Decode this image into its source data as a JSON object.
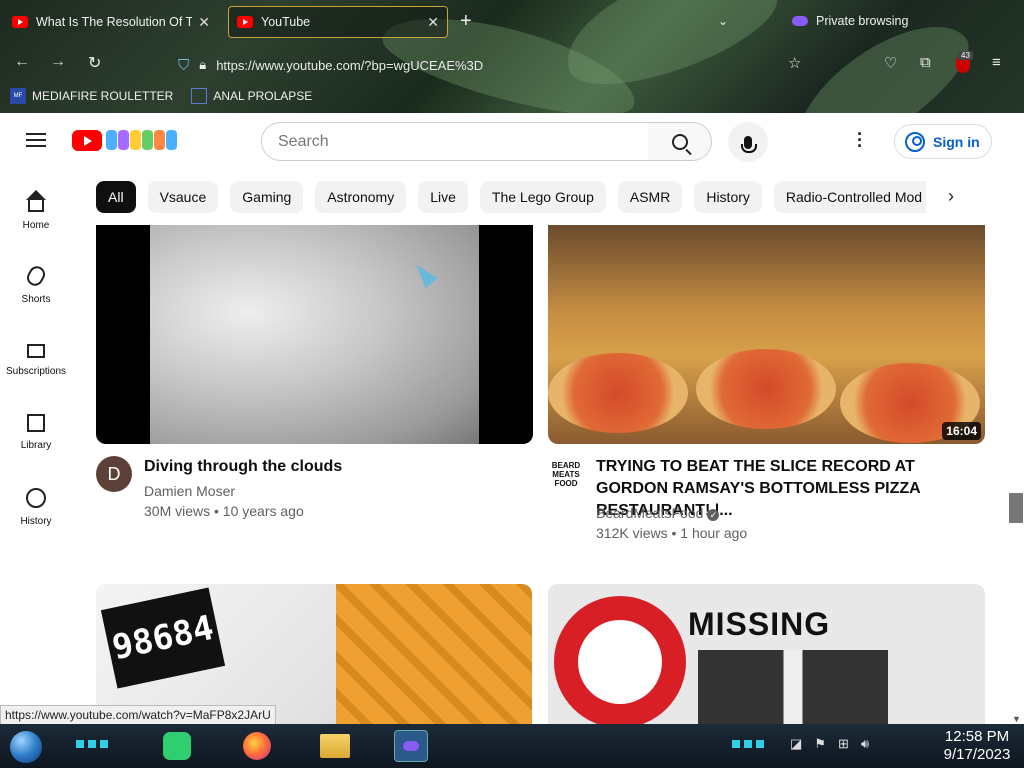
{
  "browser": {
    "tabs": [
      {
        "label": "What Is The Resolution Of The"
      },
      {
        "label": "YouTube"
      }
    ],
    "private_label": "Private browsing",
    "url": "https://www.youtube.com/?bp=wgUCEAE%3D",
    "extension_badge": "43",
    "bookmarks": [
      {
        "label": "MEDIAFIRE ROULETTER"
      },
      {
        "label": "ANAL PROLAPSE"
      }
    ]
  },
  "youtube": {
    "search_placeholder": "Search",
    "sign_in": "Sign in",
    "doodle_letters": [
      "",
      "",
      "",
      "",
      "",
      ""
    ],
    "chips": [
      "All",
      "Vsauce",
      "Gaming",
      "Astronomy",
      "Live",
      "The Lego Group",
      "ASMR",
      "History",
      "Radio-Controlled Mod"
    ],
    "sidebar": [
      {
        "label": "Home"
      },
      {
        "label": "Shorts"
      },
      {
        "label": "Subscriptions"
      },
      {
        "label": "Library"
      },
      {
        "label": "History"
      }
    ],
    "videos": [
      {
        "title": "Diving through the clouds",
        "channel": "Damien Moser",
        "avatar_letter": "D",
        "meta": "30M views • 10 years ago"
      },
      {
        "title": "TRYING TO BEAT THE SLICE RECORD AT GORDON RAMSAY'S BOTTOMLESS PIZZA RESTAURANT! |...",
        "channel": "BeardMeatsFood",
        "avatar_text": "BEARD MEATS FOOD",
        "meta": "312K views • 1 hour ago",
        "duration": "16:04"
      }
    ],
    "thumb3_counter": "98684",
    "thumb4_text": "MISSING"
  },
  "status_url": "https://www.youtube.com/watch?v=MaFP8x2JArU",
  "taskbar": {
    "time": "12:58 PM",
    "date": "9/17/2023"
  },
  "colors": {
    "yt_red": "#ff0000",
    "link_blue": "#065fd4",
    "chip_active": "#0f0f0f"
  }
}
